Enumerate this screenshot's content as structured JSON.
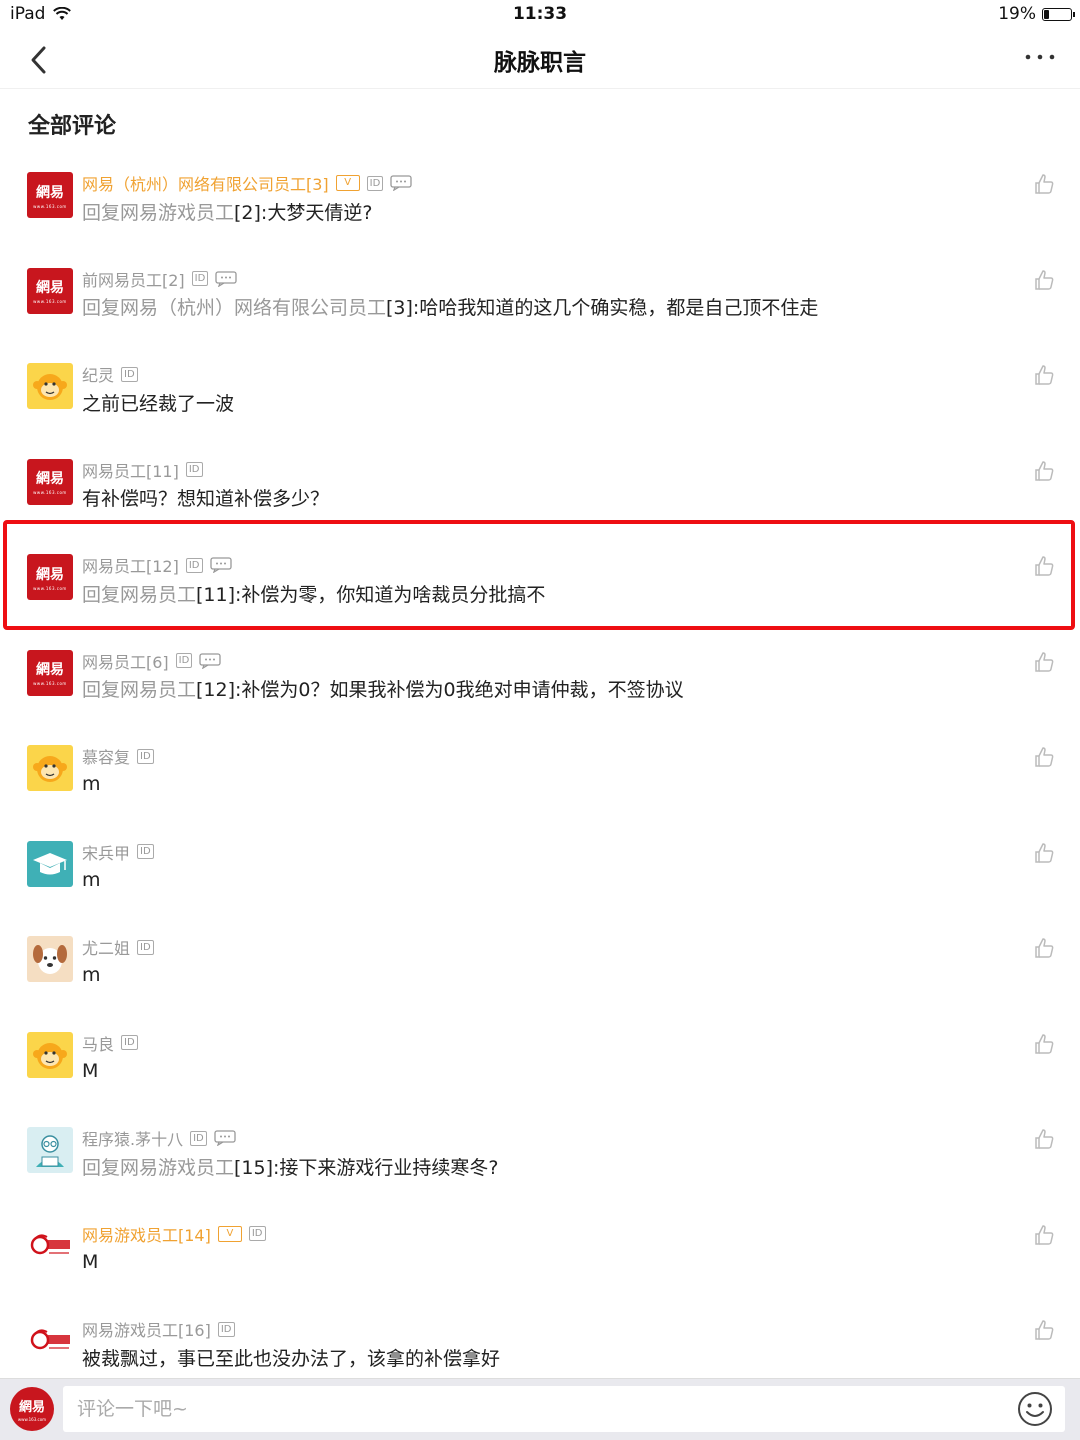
{
  "status_bar": {
    "device": "iPad",
    "time": "11:33",
    "battery_text": "19%",
    "battery_level": 0.19
  },
  "nav": {
    "title": "脉脉职言"
  },
  "section": {
    "title": "全部评论"
  },
  "comments": [
    {
      "avatar": "netease-logo",
      "avatar_text": "網易",
      "avatar_sub": "www.163.com",
      "name": "网易（杭州）网络有限公司员工[3]",
      "name_color": "orange",
      "vip": true,
      "reply": true,
      "reply_prefix": "回复网易游戏员工",
      "text": "[2]:大梦天倩逆?"
    },
    {
      "avatar": "netease-logo",
      "avatar_text": "網易",
      "avatar_sub": "www.163.com",
      "name": "前网易员工[2]",
      "vip": false,
      "reply": true,
      "reply_prefix": "回复网易（杭州）网络有限公司员工",
      "text": "[3]:哈哈我知道的这几个确实稳，都是自己顶不住走"
    },
    {
      "avatar": "monkey",
      "name": "纪灵",
      "vip": false,
      "reply": false,
      "text": "之前已经裁了一波"
    },
    {
      "avatar": "netease-logo",
      "avatar_text": "網易",
      "avatar_sub": "www.163.com",
      "name": "网易员工[11]",
      "vip": false,
      "reply": false,
      "text": "有补偿吗？想知道补偿多少？"
    },
    {
      "avatar": "netease-logo",
      "avatar_text": "網易",
      "avatar_sub": "www.163.com",
      "name": "网易员工[12]",
      "vip": false,
      "reply": true,
      "reply_prefix": "回复网易员工",
      "text": "[11]:补偿为零，你知道为啥裁员分批搞不"
    },
    {
      "avatar": "netease-logo",
      "avatar_text": "網易",
      "avatar_sub": "www.163.com",
      "name": "网易员工[6]",
      "vip": false,
      "reply": true,
      "reply_prefix": "回复网易员工",
      "text": "[12]:补偿为0？如果我补偿为0我绝对申请仲裁，不签协议"
    },
    {
      "avatar": "monkey",
      "name": "慕容复",
      "vip": false,
      "reply": false,
      "text": "m"
    },
    {
      "avatar": "graduation-cap",
      "name": "宋兵甲",
      "vip": false,
      "reply": false,
      "text": "m"
    },
    {
      "avatar": "dog",
      "name": "尤二姐",
      "vip": false,
      "reply": false,
      "text": "m"
    },
    {
      "avatar": "monkey",
      "name": "马良",
      "vip": false,
      "reply": false,
      "text": "M"
    },
    {
      "avatar": "coder",
      "name": "程序猿.茅十八",
      "vip": false,
      "reply": true,
      "reply_prefix": "回复网易游戏员工",
      "text": "[15]:接下来游戏行业持续寒冬?"
    },
    {
      "avatar": "netease-games",
      "name": "网易游戏员工[14]",
      "name_color": "orange",
      "vip": true,
      "reply": false,
      "text": "M"
    },
    {
      "avatar": "netease-games",
      "name": "网易游戏员工[16]",
      "vip": false,
      "reply": false,
      "text": "被裁飘过，事已至此也没办法了，该拿的补偿拿好"
    }
  ],
  "highlighted_comment_index": 4,
  "badges": {
    "id_label": "ID",
    "vip_label": "V"
  },
  "input": {
    "placeholder": "评论一下吧~"
  },
  "bottom_avatar": {
    "text": "網易",
    "sub": "www.163.com"
  },
  "colors": {
    "accent_orange": "#f0a232",
    "highlight_red": "#ee0e12",
    "netease_red": "#c8161e",
    "muted_text": "#999999"
  }
}
